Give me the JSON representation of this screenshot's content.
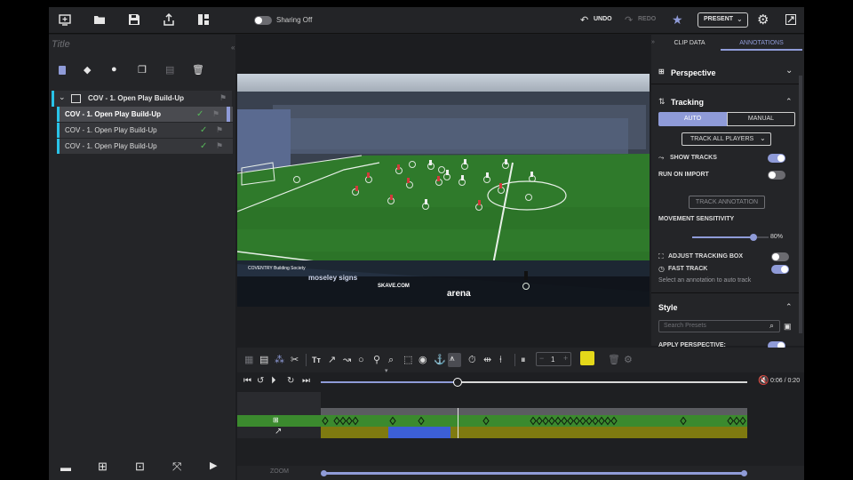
{
  "topbar": {
    "sharing_label": "Sharing Off",
    "undo_label": "UNDO",
    "redo_label": "REDO",
    "present_label": "PRESENT"
  },
  "left": {
    "title_placeholder": "Title",
    "group_label": "COV - 1. Open Play Build-Up",
    "clips": [
      {
        "label": "COV - 1. Open Play Build-Up",
        "selected": true
      },
      {
        "label": "COV - 1. Open Play Build-Up",
        "selected": false
      },
      {
        "label": "COV - 1. Open Play Build-Up",
        "selected": false
      }
    ]
  },
  "video": {
    "sponsor_1": "moseley signs",
    "sponsor_2": "arena",
    "sponsor_3": "COVENTRY Building Society",
    "sponsor_4": "SKAVE.COM"
  },
  "right": {
    "tabs": [
      "CLIP DATA",
      "ANNOTATIONS"
    ],
    "active_tab": "ANNOTATIONS",
    "perspective_title": "Perspective",
    "tracking_title": "Tracking",
    "mode_auto": "AUTO",
    "mode_manual": "MANUAL",
    "track_select": "TRACK ALL PLAYERS",
    "show_tracks": "SHOW TRACKS",
    "run_on_import": "RUN ON IMPORT",
    "track_annotation": "TRACK ANNOTATION",
    "movement_sensitivity": "MOVEMENT SENSITIVITY",
    "sensitivity_value": "80%",
    "sensitivity_fraction": 0.8,
    "adjust_tracking_box": "ADJUST TRACKING BOX",
    "fast_track": "FAST TRACK",
    "hint": "Select an annotation to auto track",
    "style_title": "Style",
    "search_placeholder": "Search Presets",
    "apply_perspective": "APPLY PERSPECTIVE:"
  },
  "toolbar": {
    "frame_value": "1",
    "color": "#e4d81a"
  },
  "transport": {
    "time": "0:06 / 0:20",
    "progress_fraction": 0.32
  },
  "zoom": {
    "label": "ZOOM"
  },
  "colors": {
    "accent": "#8f9bd8",
    "clip_bar": "#29c3e8",
    "track_green": "#3b8a2e",
    "track_olive": "#7f7a10",
    "track_blue": "#3c5fd6",
    "present_border": "#cfcfcf"
  }
}
